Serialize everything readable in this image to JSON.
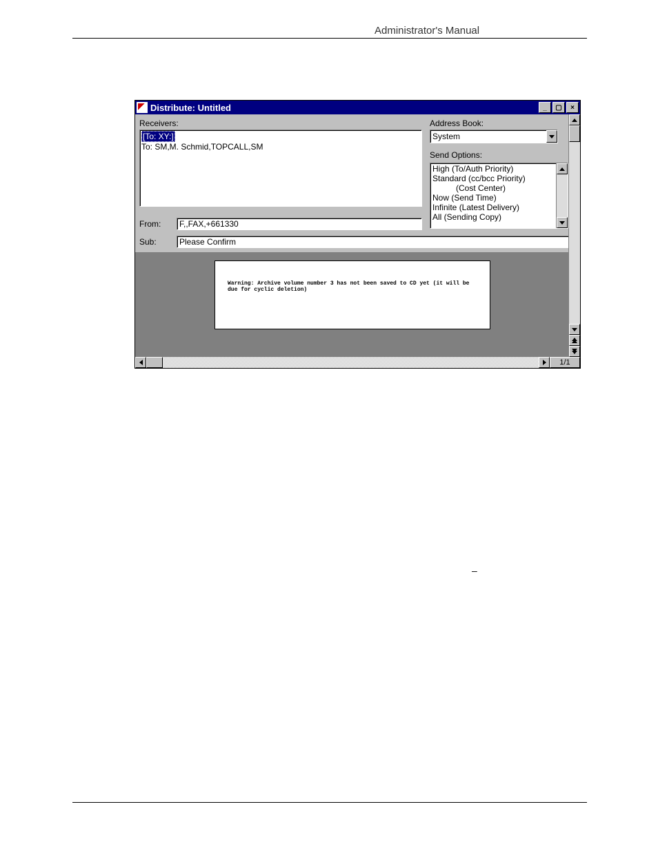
{
  "header": {
    "title": "Administrator's Manual"
  },
  "misc": {
    "dash": "–"
  },
  "window": {
    "title": "Distribute: Untitled",
    "controls": {
      "min": "_",
      "max": "▢",
      "close": "×"
    },
    "labels": {
      "receivers": "Receivers:",
      "from": "From:",
      "sub": "Sub:",
      "address_book": "Address Book:",
      "send_options": "Send Options:"
    },
    "receivers": {
      "selected": "[To: XY:]",
      "line2": "To: SM,M. Schmid,TOPCALL,SM"
    },
    "from": "F,,FAX,+661330",
    "sub": "Please Confirm",
    "address_book": {
      "value": "System"
    },
    "send_options": [
      "High   (To/Auth Priority)",
      "Standard   (cc/bcc Priority)",
      "   (Cost Center)",
      "Now   (Send Time)",
      "Infinite   (Latest Delivery)",
      "All   (Sending Copy)"
    ],
    "preview_text": "Warning: Archive volume number 3 has not been saved to CD yet (it will be due for cyclic deletion)",
    "page_indicator": "1/1"
  }
}
